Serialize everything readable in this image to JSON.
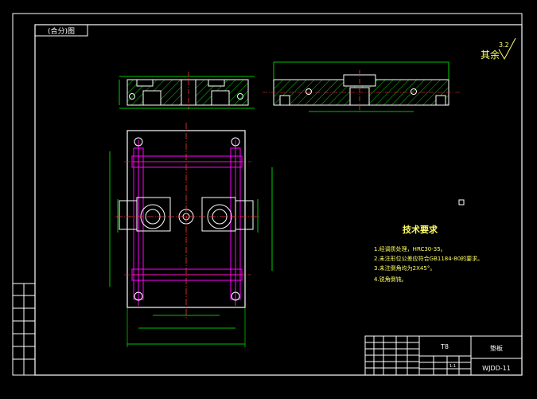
{
  "sheet": {
    "top_stamp": "(合分)图",
    "surface_finish": {
      "prefix": "其余",
      "value": "3.2"
    },
    "notes_title": "技术要求",
    "notes": [
      "1.经调质处理，HRC30-35。",
      "2.未注形位公差应符合GB1184-80的要求。",
      "3.未注倒角均为2X45°。",
      "4.锐角倒钝。"
    ],
    "title_block": {
      "material": "T8",
      "part_name": "垫板",
      "drawing_no": "WJDD-11",
      "scale": "1:1"
    }
  },
  "colors": {
    "background": "#000000",
    "border": "#ffffff",
    "outline": "#ffffff",
    "hatch": "#00ff00",
    "centerline": "#ff3333",
    "magenta": "#ff00ff",
    "dimension": "#00ff00",
    "text": "#ffff66"
  }
}
